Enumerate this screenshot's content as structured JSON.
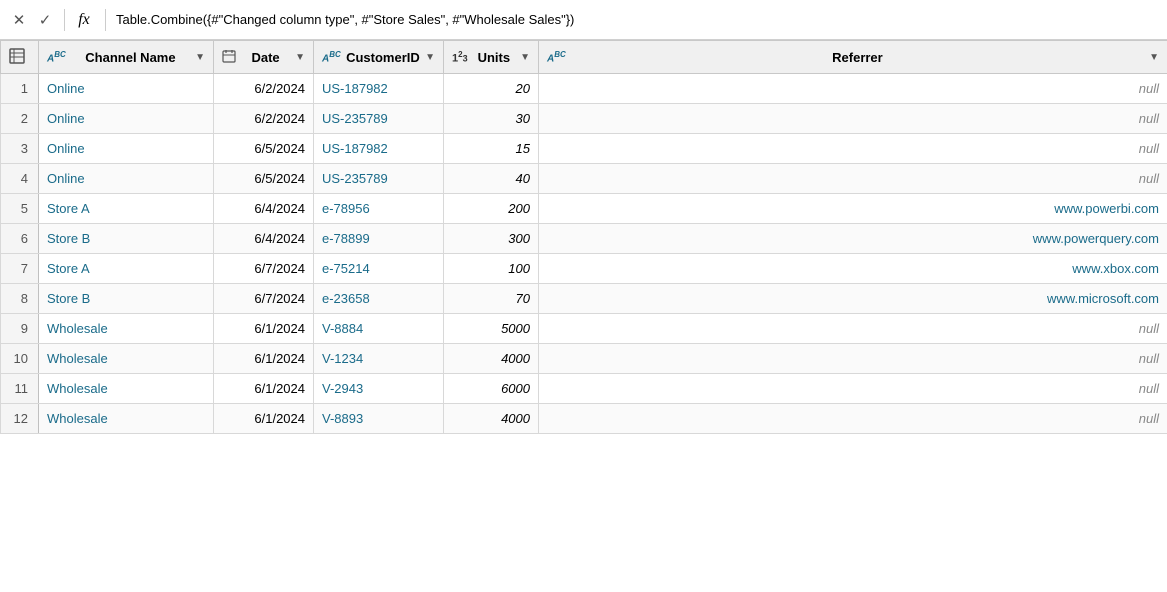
{
  "formulaBar": {
    "cancelIcon": "✕",
    "confirmIcon": "✓",
    "fxLabel": "fx",
    "formula": "Table.Combine({#\"Changed column type\", #\"Store Sales\", #\"Wholesale Sales\"})"
  },
  "table": {
    "columns": [
      {
        "id": "row-num",
        "label": "",
        "typeIcon": "",
        "hasDropdown": false
      },
      {
        "id": "channel-name",
        "label": "Channel Name",
        "typeIcon": "ABC",
        "hasDropdown": true
      },
      {
        "id": "date",
        "label": "Date",
        "typeIcon": "CAL",
        "hasDropdown": true
      },
      {
        "id": "customer-id",
        "label": "CustomerID",
        "typeIcon": "ABC",
        "hasDropdown": true
      },
      {
        "id": "units",
        "label": "Units",
        "typeIcon": "123",
        "hasDropdown": true
      },
      {
        "id": "referrer",
        "label": "Referrer",
        "typeIcon": "ABC",
        "hasDropdown": true
      }
    ],
    "rows": [
      {
        "num": "1",
        "channelName": "Online",
        "date": "6/2/2024",
        "customerId": "US-187982",
        "units": "20",
        "referrer": "null"
      },
      {
        "num": "2",
        "channelName": "Online",
        "date": "6/2/2024",
        "customerId": "US-235789",
        "units": "30",
        "referrer": "null"
      },
      {
        "num": "3",
        "channelName": "Online",
        "date": "6/5/2024",
        "customerId": "US-187982",
        "units": "15",
        "referrer": "null"
      },
      {
        "num": "4",
        "channelName": "Online",
        "date": "6/5/2024",
        "customerId": "US-235789",
        "units": "40",
        "referrer": "null"
      },
      {
        "num": "5",
        "channelName": "Store A",
        "date": "6/4/2024",
        "customerId": "e-78956",
        "units": "200",
        "referrer": "www.powerbi.com"
      },
      {
        "num": "6",
        "channelName": "Store B",
        "date": "6/4/2024",
        "customerId": "e-78899",
        "units": "300",
        "referrer": "www.powerquery.com"
      },
      {
        "num": "7",
        "channelName": "Store A",
        "date": "6/7/2024",
        "customerId": "e-75214",
        "units": "100",
        "referrer": "www.xbox.com"
      },
      {
        "num": "8",
        "channelName": "Store B",
        "date": "6/7/2024",
        "customerId": "e-23658",
        "units": "70",
        "referrer": "www.microsoft.com"
      },
      {
        "num": "9",
        "channelName": "Wholesale",
        "date": "6/1/2024",
        "customerId": "V-8884",
        "units": "5000",
        "referrer": "null"
      },
      {
        "num": "10",
        "channelName": "Wholesale",
        "date": "6/1/2024",
        "customerId": "V-1234",
        "units": "4000",
        "referrer": "null"
      },
      {
        "num": "11",
        "channelName": "Wholesale",
        "date": "6/1/2024",
        "customerId": "V-2943",
        "units": "6000",
        "referrer": "null"
      },
      {
        "num": "12",
        "channelName": "Wholesale",
        "date": "6/1/2024",
        "customerId": "V-8893",
        "units": "4000",
        "referrer": "null"
      }
    ]
  }
}
